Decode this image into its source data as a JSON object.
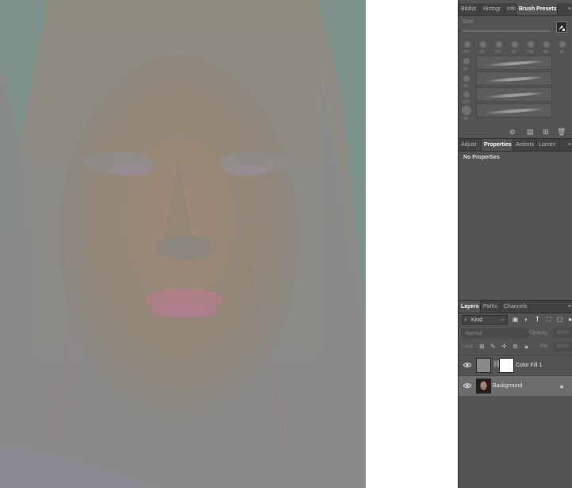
{
  "panels": {
    "top_tabs": [
      "Bibliot",
      "Histogr",
      "Info",
      "Brush Presets"
    ],
    "brush": {
      "size_label": "Size:",
      "sizes": [
        "251",
        "92",
        "211",
        "93",
        "215",
        "95",
        "95"
      ],
      "side_sizes": [
        "",
        "90",
        "94",
        "423",
        "90"
      ]
    },
    "mid_tabs": [
      "Adjust",
      "Properties",
      "Actions",
      "Lumen"
    ],
    "properties": {
      "empty_text": "No Properties"
    },
    "layer_tabs": [
      "Layers",
      "Paths",
      "Channels"
    ],
    "layers_panel": {
      "kind_label": "Kind",
      "blend_mode": "Normal",
      "opacity_label": "Opacity:",
      "opacity_value": "100%",
      "lock_label": "Lock:",
      "fill_label": "Fill:",
      "fill_value": "100%",
      "layers": [
        {
          "name": "Color Fill 1",
          "visible": true,
          "selected": false
        },
        {
          "name": "Background",
          "visible": true,
          "selected": true
        }
      ]
    }
  },
  "colors": {
    "panel_bg": "#535353",
    "tab_bg": "#424242",
    "selected_layer": "#6c6c6c",
    "canvas_tint": "#8b8887"
  }
}
